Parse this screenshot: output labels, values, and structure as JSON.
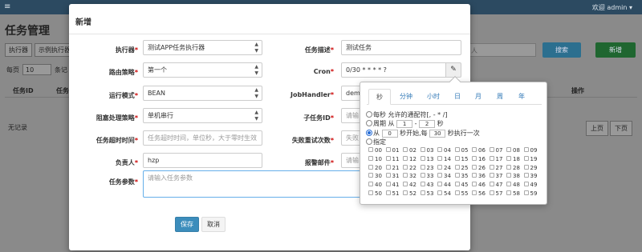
{
  "navbar": {
    "menu_icon": "≡",
    "user": "欢迎 admin ▾"
  },
  "background": {
    "title": "任务管理",
    "tabs": [
      "执行器",
      "示例执行器"
    ],
    "per_page_label": "每页",
    "per_page_value": "10",
    "per_page_suffix": "条记",
    "search_placeholder": "人",
    "search_button": "搜索",
    "add_button": "新增",
    "columns": [
      "任务ID",
      "任务",
      "操作"
    ],
    "no_records": "无记录",
    "prev_page": "上页",
    "next_page": "下页"
  },
  "modal": {
    "title": "新增",
    "fields": {
      "executor": {
        "label": "执行器",
        "value": "测试APP任务执行器"
      },
      "desc": {
        "label": "任务描述",
        "value": "测试任务"
      },
      "route": {
        "label": "路由策略",
        "value": "第一个"
      },
      "cron": {
        "label": "Cron",
        "value": "0/30 * * * * ?"
      },
      "glue": {
        "label": "运行模式",
        "value": "BEAN"
      },
      "handler": {
        "label": "JobHandler",
        "value": "dem"
      },
      "block": {
        "label": "阻塞处理策略",
        "value": "单机串行"
      },
      "child": {
        "label": "子任务ID",
        "placeholder": "请输"
      },
      "timeout": {
        "label": "任务超时时间",
        "placeholder": "任务超时时间，单位秒，大于零时生效"
      },
      "retry": {
        "label": "失败重试次数",
        "placeholder": "失败"
      },
      "author": {
        "label": "负责人",
        "value": "hzp"
      },
      "alarm": {
        "label": "报警邮件",
        "placeholder": "请输"
      },
      "param": {
        "label": "任务参数",
        "placeholder": "请输入任务参数"
      }
    },
    "save": "保存",
    "cancel": "取消",
    "cron_icon": "edit-icon"
  },
  "cron_popover": {
    "tabs": [
      "秒",
      "分钟",
      "小时",
      "日",
      "月",
      "周",
      "年"
    ],
    "active_tab": "秒",
    "opt_every": "每秒 允许的通配符[, - * /]",
    "opt_cycle_prefix": "周期 从",
    "cycle_from": "1",
    "cycle_dash": "-",
    "cycle_to": "2",
    "cycle_unit": "秒",
    "opt_from_prefix": "从",
    "from_start": "0",
    "from_mid": "秒开始,每",
    "from_step": "30",
    "from_suffix": "秒执行一次",
    "opt_specify": "指定",
    "seconds": [
      "00",
      "01",
      "02",
      "03",
      "04",
      "05",
      "06",
      "07",
      "08",
      "09",
      "10",
      "11",
      "12",
      "13",
      "14",
      "15",
      "16",
      "17",
      "18",
      "19",
      "20",
      "21",
      "22",
      "23",
      "24",
      "25",
      "26",
      "27",
      "28",
      "29",
      "30",
      "31",
      "32",
      "33",
      "34",
      "35",
      "36",
      "37",
      "38",
      "39",
      "40",
      "41",
      "42",
      "43",
      "44",
      "45",
      "46",
      "47",
      "48",
      "49",
      "50",
      "51",
      "52",
      "53",
      "54",
      "55",
      "56",
      "57",
      "58",
      "59"
    ]
  }
}
